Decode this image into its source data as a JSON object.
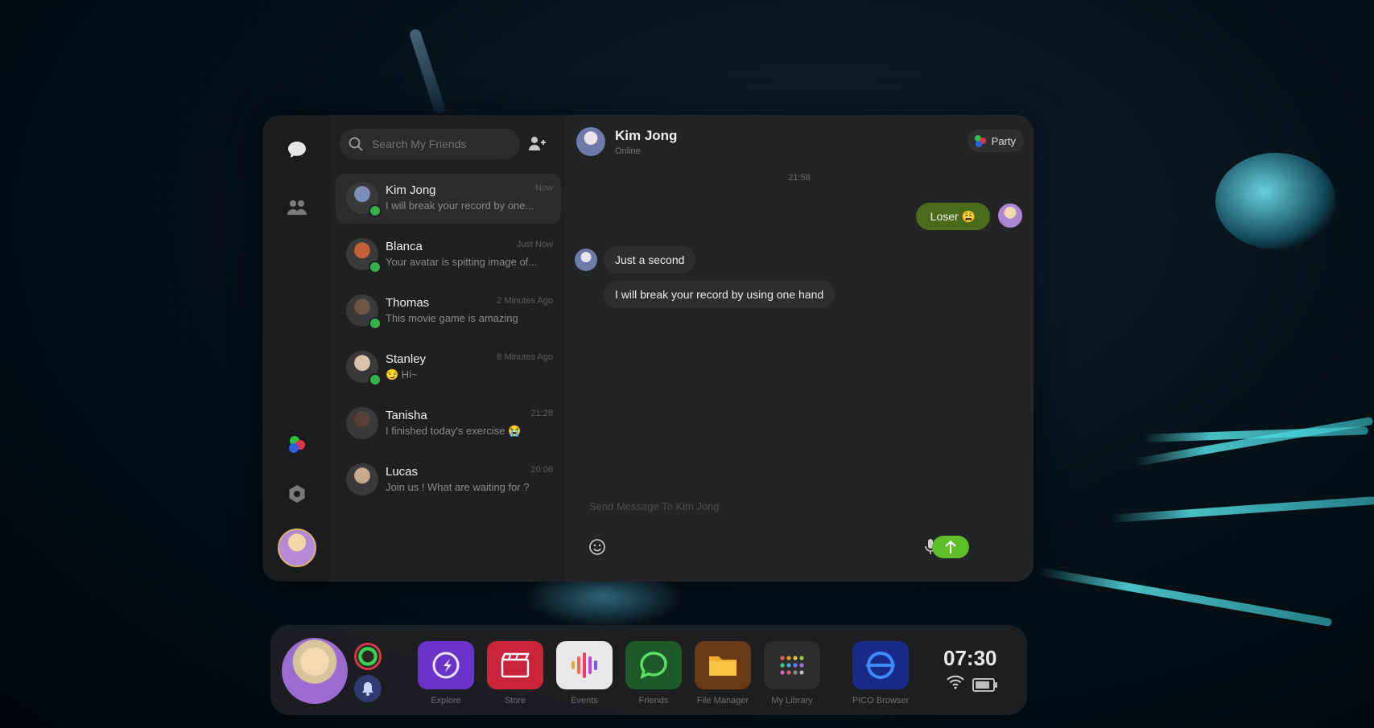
{
  "search": {
    "placeholder": "Search My Friends"
  },
  "conversations": [
    {
      "name": "Kim Jong",
      "message": "I will break your record by one...",
      "time": "Now",
      "online": true,
      "avatar_color": "#7d8fb8",
      "active": true
    },
    {
      "name": "Blanca",
      "message": "Your avatar is spitting image of...",
      "time": "Just Now",
      "online": true,
      "avatar_color": "#c2603a",
      "active": false
    },
    {
      "name": "Thomas",
      "message": "This movie game is amazing",
      "time": "2 Minutes Ago",
      "online": true,
      "avatar_color": "#6b5644",
      "active": false
    },
    {
      "name": "Stanley",
      "message": "😏 Hi~",
      "time": "8 Minutes Ago",
      "online": true,
      "avatar_color": "#d9c3a8",
      "active": false
    },
    {
      "name": "Tanisha",
      "message": "I finished today's exercise 😭",
      "time": "21:28",
      "online": false,
      "avatar_color": "#5a3e38",
      "active": false
    },
    {
      "name": "Lucas",
      "message": "Join us ! What are waiting for ?",
      "time": "20:06",
      "online": false,
      "avatar_color": "#c7aa8e",
      "active": false
    }
  ],
  "chat": {
    "contact_name": "Kim Jong",
    "status": "Online",
    "party_label": "Party",
    "timestamp": "21:58",
    "outgoing": "Loser 😩",
    "incoming": [
      "Just a second",
      "I will break your record by using one hand"
    ],
    "composer_placeholder": "Send Message To Kim Jong"
  },
  "dock": {
    "apps": [
      {
        "label": "Explore",
        "color": "#6b34c8",
        "icon": "compass-icon"
      },
      {
        "label": "Store",
        "color": "#c9243a",
        "icon": "clapper-icon"
      },
      {
        "label": "Events",
        "color": "#e8e8ea",
        "icon": "soundwave-icon"
      },
      {
        "label": "Friends",
        "color": "#1d5a2a",
        "icon": "chat-ring-icon"
      },
      {
        "label": "File Manager",
        "color": "#6a3a18",
        "icon": "folder-icon"
      },
      {
        "label": "My Library",
        "color": "#2c2d2f",
        "icon": "grid-icon"
      },
      {
        "label": "PICO Browser",
        "color": "#1a2a88",
        "icon": "browser-icon"
      }
    ],
    "clock": "07:30",
    "battery_level": 0.85
  },
  "colors": {
    "accent_green": "#5fbf2a",
    "outgoing_bubble": "#4a6b1a",
    "online": "#35b04a"
  }
}
